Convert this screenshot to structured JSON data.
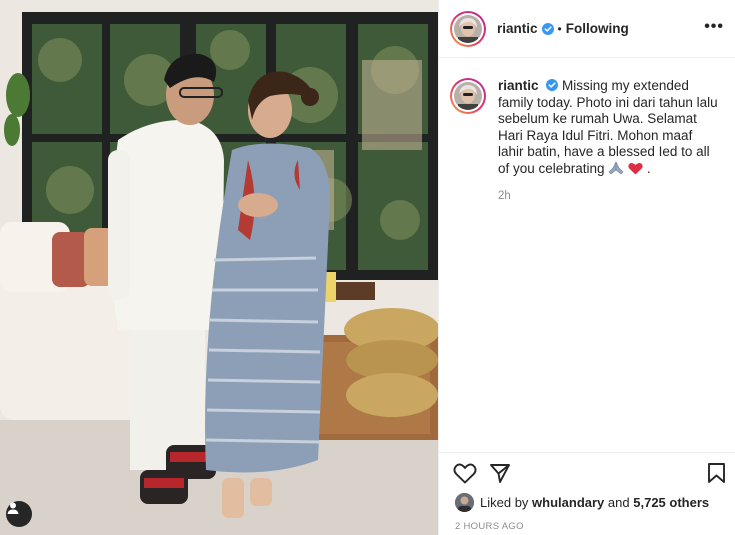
{
  "post": {
    "username": "riantic",
    "dot": "•",
    "follow_label": "Following",
    "more_label": "•••"
  },
  "caption": {
    "username": "riantic",
    "text": "Missing my extended family today. Photo ini dari tahun lalu sebelum ke rumah Uwa. Selamat Hari Raya Idul Fitri. Mohon maaf lahir batin, have a blessed Ied to all of you celebrating",
    "emojis": [
      "pray-emoji",
      "red-heart-emoji"
    ],
    "end_punct": ".",
    "time": "2h"
  },
  "likes": {
    "prefix": "Liked by",
    "user": "whulandary",
    "joiner": "and",
    "others": "5,725 others"
  },
  "timestamp": "2 HOURS AGO",
  "icons": {
    "like": "heart-outline-icon",
    "share": "paper-plane-icon",
    "save": "bookmark-icon",
    "tags": "user-tag-icon",
    "more": "more-options-icon",
    "verified": "verified-badge-icon"
  },
  "colors": {
    "verified_blue": "#3897f0",
    "text": "#262626",
    "muted": "#8e8e8e",
    "story_ring_start": "#f9a33f",
    "story_ring_end": "#b22fa3"
  }
}
